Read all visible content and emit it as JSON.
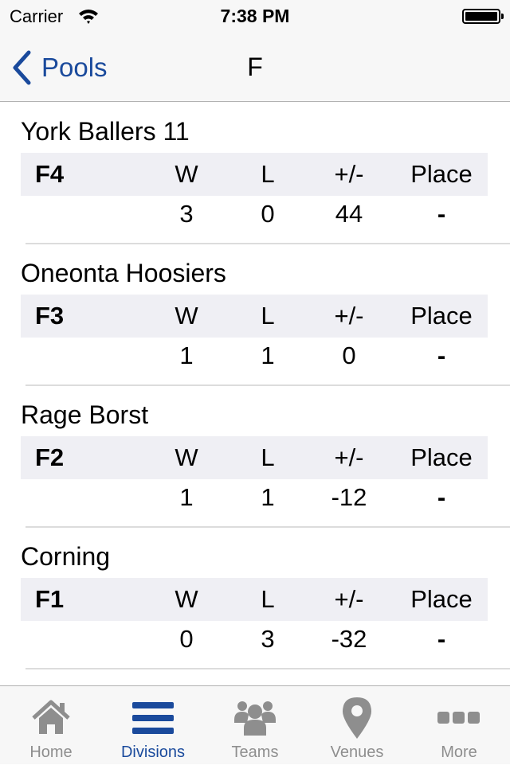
{
  "status_bar": {
    "carrier": "Carrier",
    "time": "7:38 PM",
    "wifi_icon": "wifi-icon",
    "battery_icon": "battery-icon",
    "battery_level": 1.0
  },
  "nav": {
    "back_label": "Pools",
    "back_icon": "chevron-left-icon",
    "title": "F"
  },
  "columns": {
    "wins": "W",
    "losses": "L",
    "diff": "+/-",
    "place": "Place"
  },
  "teams": [
    {
      "name": "York Ballers 11",
      "pool": "F4",
      "wins": "3",
      "losses": "0",
      "diff": "44",
      "place": "-"
    },
    {
      "name": "Oneonta Hoosiers",
      "pool": "F3",
      "wins": "1",
      "losses": "1",
      "diff": "0",
      "place": "-"
    },
    {
      "name": "Rage Borst",
      "pool": "F2",
      "wins": "1",
      "losses": "1",
      "diff": "-12",
      "place": "-"
    },
    {
      "name": "Corning",
      "pool": "F1",
      "wins": "0",
      "losses": "3",
      "diff": "-32",
      "place": "-"
    }
  ],
  "tabbar": {
    "active_color": "#1a4a9c",
    "inactive_color": "#8e8e8e",
    "items": [
      {
        "label": "Home",
        "icon": "home-icon",
        "active": false
      },
      {
        "label": "Divisions",
        "icon": "list-icon",
        "active": true
      },
      {
        "label": "Teams",
        "icon": "people-icon",
        "active": false
      },
      {
        "label": "Venues",
        "icon": "map-pin-icon",
        "active": false
      },
      {
        "label": "More",
        "icon": "more-icon",
        "active": false
      }
    ]
  }
}
